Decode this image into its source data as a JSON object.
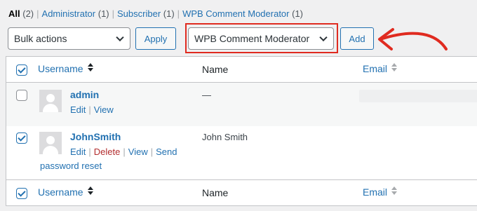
{
  "views": [
    {
      "label": "All",
      "count": "(2)"
    },
    {
      "label": "Administrator",
      "count": "(1)"
    },
    {
      "label": "Subscriber",
      "count": "(1)"
    },
    {
      "label": "WPB Comment Moderator",
      "count": "(1)"
    }
  ],
  "toolbar": {
    "bulk_actions": "Bulk actions",
    "apply_label": "Apply",
    "role_select": "WPB Comment Moderator",
    "add_label": "Add"
  },
  "table": {
    "columns": {
      "username": "Username",
      "name": "Name",
      "email": "Email"
    },
    "rows": [
      {
        "username": "admin",
        "name": "—",
        "checked": false,
        "actions": [
          "Edit",
          "View"
        ]
      },
      {
        "username": "JohnSmith",
        "name": "John Smith",
        "checked": true,
        "actions": [
          "Edit",
          "Delete",
          "View",
          "Send",
          "password reset"
        ]
      }
    ]
  },
  "colors": {
    "accent": "#2271b1",
    "delete": "#b32d2e",
    "highlight": "#e02b20"
  },
  "icons": [
    "chevron-down-icon",
    "sort-arrows-icon",
    "avatar-placeholder-icon",
    "checkbox-icon",
    "annotation-arrow-icon"
  ]
}
